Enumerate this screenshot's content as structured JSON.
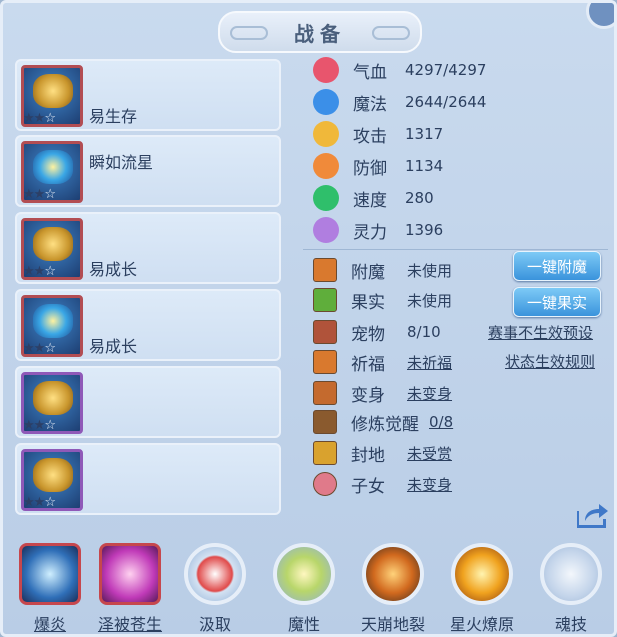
{
  "title": "战备",
  "equipment": [
    {
      "name": "易生存",
      "stars": 2,
      "max_stars": 3
    },
    {
      "name": "瞬如流星",
      "stars": 2,
      "max_stars": 3
    },
    {
      "name": "易成长",
      "stars": 2,
      "max_stars": 3
    },
    {
      "name": "易成长",
      "stars": 2,
      "max_stars": 3
    },
    {
      "name": "",
      "stars": 2,
      "max_stars": 3
    },
    {
      "name": "",
      "stars": 2,
      "max_stars": 3
    }
  ],
  "stats": [
    {
      "label": "气血",
      "value": "4297/4297",
      "icon": "heart-icon",
      "color": "#e8556d"
    },
    {
      "label": "魔法",
      "value": "2644/2644",
      "icon": "mana-icon",
      "color": "#3b8fe8"
    },
    {
      "label": "攻击",
      "value": "1317",
      "icon": "attack-icon",
      "color": "#f0b83a"
    },
    {
      "label": "防御",
      "value": "1134",
      "icon": "defense-icon",
      "color": "#f08a3a"
    },
    {
      "label": "速度",
      "value": "280",
      "icon": "speed-icon",
      "color": "#2fbf6b"
    },
    {
      "label": "灵力",
      "value": "1396",
      "icon": "spirit-icon",
      "color": "#b07ee0"
    }
  ],
  "extras": [
    {
      "label": "附魔",
      "value": "未使用",
      "underline": false,
      "icon": "enchant-icon",
      "color": "#d9792e"
    },
    {
      "label": "果实",
      "value": "未使用",
      "underline": false,
      "icon": "fruit-icon",
      "color": "#5fae3b"
    },
    {
      "label": "宠物",
      "value": "8/10",
      "underline": false,
      "icon": "pet-icon",
      "color": "#b0533a"
    },
    {
      "label": "祈福",
      "value": "未祈福",
      "underline": true,
      "icon": "pray-icon",
      "color": "#d9792e"
    },
    {
      "label": "变身",
      "value": "未变身",
      "underline": true,
      "icon": "transform-icon",
      "color": "#c46a2e"
    },
    {
      "label": "修炼觉醒",
      "value": "0/8",
      "underline": true,
      "icon": "awaken-icon",
      "color": "#8a5a2e"
    },
    {
      "label": "封地",
      "value": "未受赏",
      "underline": true,
      "icon": "fief-icon",
      "color": "#d9a22e"
    },
    {
      "label": "子女",
      "value": "未变身",
      "underline": true,
      "icon": "child-icon",
      "color": "#e07a8a"
    }
  ],
  "buttons": {
    "enchant": "一键附魔",
    "fruit": "一键果实"
  },
  "links": {
    "preset": "赛事不生效预设",
    "rules": "状态生效规则"
  },
  "skills": [
    {
      "label": "爆炎",
      "underline": true,
      "icon": "burst-flame-icon"
    },
    {
      "label": "泽被苍生",
      "underline": true,
      "icon": "blessing-hand-icon"
    },
    {
      "label": "汲取",
      "underline": false,
      "icon": "absorb-icon"
    },
    {
      "label": "魔性",
      "underline": false,
      "icon": "demonic-icon"
    },
    {
      "label": "天崩地裂",
      "underline": false,
      "icon": "earthquake-icon"
    },
    {
      "label": "星火燎原",
      "underline": false,
      "icon": "starfire-icon"
    },
    {
      "label": "魂技",
      "underline": false,
      "icon": "soul-skill-icon"
    }
  ]
}
